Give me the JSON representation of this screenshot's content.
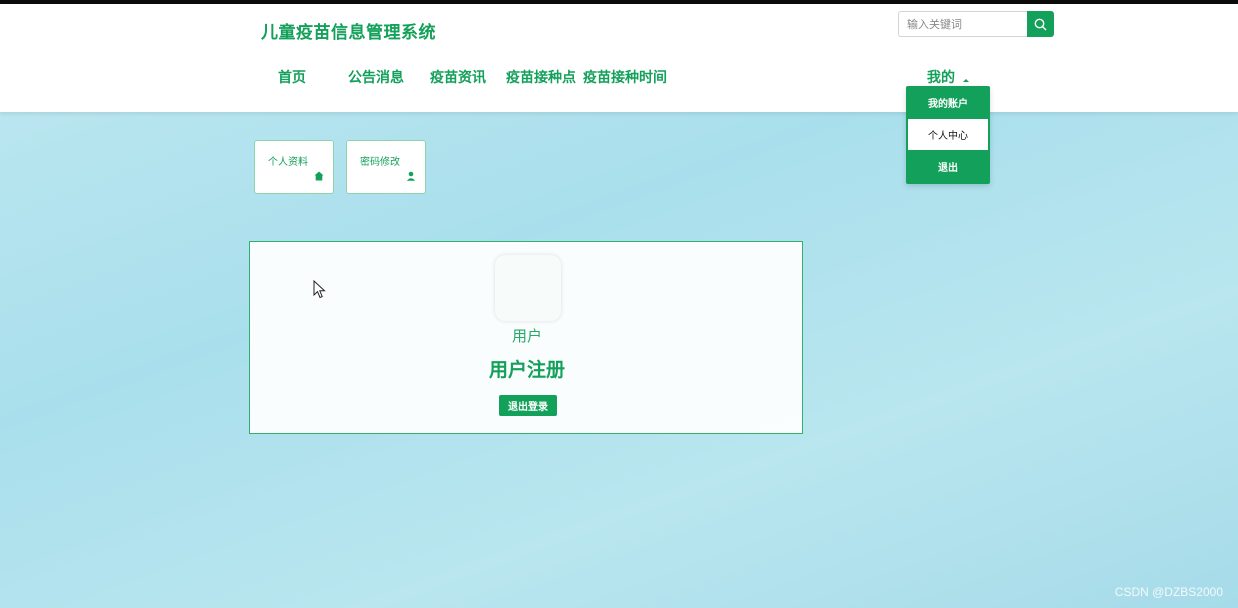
{
  "header": {
    "title": "儿童疫苗信息管理系统",
    "search": {
      "placeholder": "输入关键词",
      "value": ""
    }
  },
  "nav": {
    "items": [
      {
        "label": "首页"
      },
      {
        "label": "公告消息"
      },
      {
        "label": "疫苗资讯"
      },
      {
        "label": "疫苗接种点"
      },
      {
        "label": "疫苗接种时间"
      }
    ],
    "mine": "我的"
  },
  "dropdown": {
    "items": [
      {
        "label": "我的账户"
      },
      {
        "label": "个人中心"
      },
      {
        "label": "退出"
      }
    ]
  },
  "quick_links": [
    {
      "label": "个人资料",
      "icon": "home-icon"
    },
    {
      "label": "密码修改",
      "icon": "user-icon"
    }
  ],
  "profile": {
    "role": "用户",
    "title": "用户注册",
    "logout_label": "退出登录"
  },
  "watermark": "CSDN @DZBS2000",
  "colors": {
    "accent": "#13a05a",
    "background": "#b3e3ee"
  }
}
